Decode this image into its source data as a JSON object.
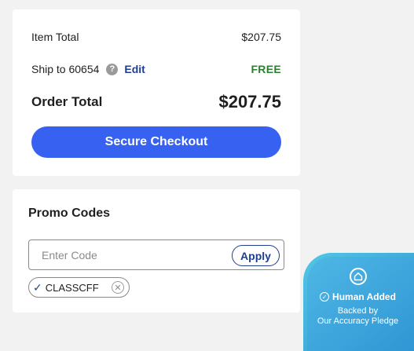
{
  "summary": {
    "item_total_label": "Item Total",
    "item_total_value": "$207.75",
    "ship_label": "Ship to 60654",
    "help_icon_glyph": "?",
    "edit_label": "Edit",
    "ship_value": "FREE",
    "order_total_label": "Order Total",
    "order_total_value": "$207.75",
    "checkout_label": "Secure Checkout"
  },
  "promo": {
    "title": "Promo Codes",
    "input_placeholder": "Enter Code",
    "input_value": "",
    "apply_label": "Apply",
    "applied_code": "CLASSCFF"
  },
  "badge": {
    "title": "Human Added",
    "line1": "Backed by",
    "line2": "Our Accuracy Pledge"
  },
  "colors": {
    "primary_button": "#3761f0",
    "link": "#1f3e8f",
    "free_text": "#2e7d32",
    "badge": "#3aa9d8"
  },
  "icons": [
    "help-icon",
    "check-icon",
    "close-icon",
    "house-icon",
    "check-circle-icon"
  ]
}
